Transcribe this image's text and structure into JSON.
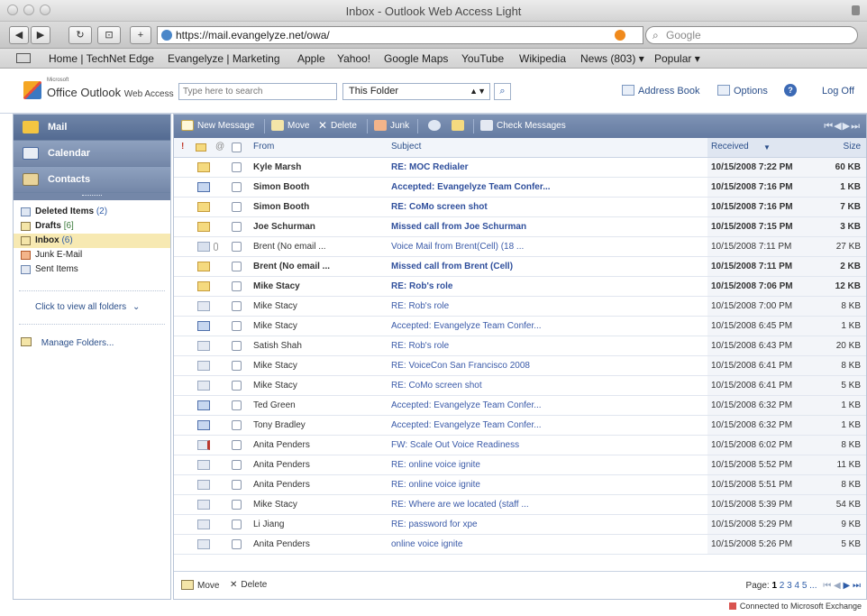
{
  "window": {
    "title": "Inbox - Outlook Web Access Light"
  },
  "browser": {
    "url": "https://mail.evangelyze.net/owa/",
    "search_placeholder": "Google",
    "bookmarks": [
      "Home | TechNet Edge",
      "Evangelyze | Marketing",
      "Apple",
      "Yahoo!",
      "Google Maps",
      "YouTube",
      "Wikipedia",
      "News (803) ▾",
      "Popular ▾"
    ]
  },
  "owa_header": {
    "logo_small": "Microsoft",
    "logo_main": "Office Outlook",
    "logo_suffix": "Web Access",
    "search_placeholder": "Type here to search",
    "scope": "This Folder",
    "address_book": "Address Book",
    "options": "Options",
    "help": "?",
    "log_off": "Log Off"
  },
  "nav": {
    "mail": "Mail",
    "calendar": "Calendar",
    "contacts": "Contacts",
    "folders": [
      {
        "name": "Deleted Items",
        "count": "(2)"
      },
      {
        "name": "Drafts",
        "count": "[6]"
      },
      {
        "name": "Inbox",
        "count": "(6)"
      },
      {
        "name": "Junk E-Mail",
        "count": ""
      },
      {
        "name": "Sent Items",
        "count": ""
      }
    ],
    "view_all": "Click to view all folders",
    "manage": "Manage Folders..."
  },
  "mail_toolbar": {
    "new_message": "New Message",
    "move": "Move",
    "delete": "Delete",
    "junk": "Junk",
    "check": "Check Messages"
  },
  "columns": {
    "from": "From",
    "subject": "Subject",
    "received": "Received",
    "size": "Size"
  },
  "messages": [
    {
      "from": "Kyle Marsh",
      "subject": "RE: MOC Redialer",
      "received": "10/15/2008 7:22 PM",
      "size": "60 KB",
      "unread": true,
      "icon": "envelope-unread"
    },
    {
      "from": "Simon Booth",
      "subject": "Accepted: Evangelyze Team Confer...",
      "received": "10/15/2008 7:16 PM",
      "size": "1 KB",
      "unread": true,
      "icon": "meeting-accepted"
    },
    {
      "from": "Simon Booth",
      "subject": "RE: CoMo screen shot",
      "received": "10/15/2008 7:16 PM",
      "size": "7 KB",
      "unread": true,
      "icon": "envelope-unread"
    },
    {
      "from": "Joe Schurman",
      "subject": "Missed call from Joe Schurman",
      "received": "10/15/2008 7:15 PM",
      "size": "3 KB",
      "unread": true,
      "icon": "envelope-unread"
    },
    {
      "from": "Brent (No email ...",
      "subject": "Voice Mail from Brent(Cell) (18 ...",
      "received": "10/15/2008 7:11 PM",
      "size": "27 KB",
      "unread": false,
      "icon": "voicemail"
    },
    {
      "from": "Brent (No email ...",
      "subject": "Missed call from Brent (Cell)",
      "received": "10/15/2008 7:11 PM",
      "size": "2 KB",
      "unread": true,
      "icon": "envelope-unread"
    },
    {
      "from": "Mike Stacy",
      "subject": "RE: Rob's role",
      "received": "10/15/2008 7:06 PM",
      "size": "12 KB",
      "unread": true,
      "icon": "envelope-unread"
    },
    {
      "from": "Mike Stacy",
      "subject": "RE: Rob's role",
      "received": "10/15/2008 7:00 PM",
      "size": "8 KB",
      "unread": false,
      "icon": "envelope-replied"
    },
    {
      "from": "Mike Stacy",
      "subject": "Accepted: Evangelyze Team Confer...",
      "received": "10/15/2008 6:45 PM",
      "size": "1 KB",
      "unread": false,
      "icon": "meeting-accepted"
    },
    {
      "from": "Satish Shah",
      "subject": "RE: Rob's role",
      "received": "10/15/2008 6:43 PM",
      "size": "20 KB",
      "unread": false,
      "icon": "envelope-read"
    },
    {
      "from": "Mike Stacy",
      "subject": "RE: VoiceCon San Francisco 2008",
      "received": "10/15/2008 6:41 PM",
      "size": "8 KB",
      "unread": false,
      "icon": "envelope-read"
    },
    {
      "from": "Mike Stacy",
      "subject": "RE: CoMo screen shot",
      "received": "10/15/2008 6:41 PM",
      "size": "5 KB",
      "unread": false,
      "icon": "envelope-read"
    },
    {
      "from": "Ted Green",
      "subject": "Accepted: Evangelyze Team Confer...",
      "received": "10/15/2008 6:32 PM",
      "size": "1 KB",
      "unread": false,
      "icon": "meeting-accepted"
    },
    {
      "from": "Tony Bradley",
      "subject": "Accepted: Evangelyze Team Confer...",
      "received": "10/15/2008 6:32 PM",
      "size": "1 KB",
      "unread": false,
      "icon": "meeting-accepted"
    },
    {
      "from": "Anita Penders",
      "subject": "FW: Scale Out Voice Readiness",
      "received": "10/15/2008 6:02 PM",
      "size": "8 KB",
      "unread": false,
      "icon": "envelope-forwarded"
    },
    {
      "from": "Anita Penders",
      "subject": "RE: online voice ignite",
      "received": "10/15/2008 5:52 PM",
      "size": "11 KB",
      "unread": false,
      "icon": "envelope-read"
    },
    {
      "from": "Anita Penders",
      "subject": "RE: online voice ignite",
      "received": "10/15/2008 5:51 PM",
      "size": "8 KB",
      "unread": false,
      "icon": "envelope-replied"
    },
    {
      "from": "Mike Stacy",
      "subject": "RE: Where are we located (staff ...",
      "received": "10/15/2008 5:39 PM",
      "size": "54 KB",
      "unread": false,
      "icon": "envelope-read"
    },
    {
      "from": "Li Jiang",
      "subject": "RE: password for xpe",
      "received": "10/15/2008 5:29 PM",
      "size": "9 KB",
      "unread": false,
      "icon": "envelope-replied"
    },
    {
      "from": "Anita Penders",
      "subject": "online voice ignite",
      "received": "10/15/2008 5:26 PM",
      "size": "5 KB",
      "unread": false,
      "icon": "envelope-replied"
    }
  ],
  "footer": {
    "move": "Move",
    "delete": "Delete",
    "page_label": "Page:",
    "current_page": "1",
    "other_pages": "2 3 4 5 ..."
  },
  "status": {
    "connection": "Connected to Microsoft Exchange"
  },
  "colors": {
    "toolbar": "#6f85a8",
    "selected_folder": "#f7e9b2",
    "link": "#2b4f8a"
  }
}
